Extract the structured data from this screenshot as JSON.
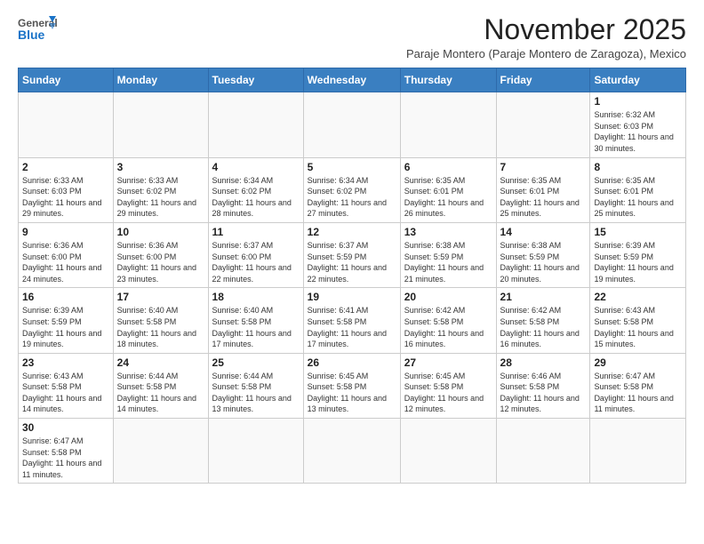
{
  "logo": {
    "general": "General",
    "blue": "Blue"
  },
  "title": "November 2025",
  "subtitle": "Paraje Montero (Paraje Montero de Zaragoza), Mexico",
  "weekdays": [
    "Sunday",
    "Monday",
    "Tuesday",
    "Wednesday",
    "Thursday",
    "Friday",
    "Saturday"
  ],
  "weeks": [
    [
      {
        "day": "",
        "info": ""
      },
      {
        "day": "",
        "info": ""
      },
      {
        "day": "",
        "info": ""
      },
      {
        "day": "",
        "info": ""
      },
      {
        "day": "",
        "info": ""
      },
      {
        "day": "",
        "info": ""
      },
      {
        "day": "1",
        "info": "Sunrise: 6:32 AM\nSunset: 6:03 PM\nDaylight: 11 hours and 30 minutes."
      }
    ],
    [
      {
        "day": "2",
        "info": "Sunrise: 6:33 AM\nSunset: 6:03 PM\nDaylight: 11 hours and 29 minutes."
      },
      {
        "day": "3",
        "info": "Sunrise: 6:33 AM\nSunset: 6:02 PM\nDaylight: 11 hours and 29 minutes."
      },
      {
        "day": "4",
        "info": "Sunrise: 6:34 AM\nSunset: 6:02 PM\nDaylight: 11 hours and 28 minutes."
      },
      {
        "day": "5",
        "info": "Sunrise: 6:34 AM\nSunset: 6:02 PM\nDaylight: 11 hours and 27 minutes."
      },
      {
        "day": "6",
        "info": "Sunrise: 6:35 AM\nSunset: 6:01 PM\nDaylight: 11 hours and 26 minutes."
      },
      {
        "day": "7",
        "info": "Sunrise: 6:35 AM\nSunset: 6:01 PM\nDaylight: 11 hours and 25 minutes."
      },
      {
        "day": "8",
        "info": "Sunrise: 6:35 AM\nSunset: 6:01 PM\nDaylight: 11 hours and 25 minutes."
      }
    ],
    [
      {
        "day": "9",
        "info": "Sunrise: 6:36 AM\nSunset: 6:00 PM\nDaylight: 11 hours and 24 minutes."
      },
      {
        "day": "10",
        "info": "Sunrise: 6:36 AM\nSunset: 6:00 PM\nDaylight: 11 hours and 23 minutes."
      },
      {
        "day": "11",
        "info": "Sunrise: 6:37 AM\nSunset: 6:00 PM\nDaylight: 11 hours and 22 minutes."
      },
      {
        "day": "12",
        "info": "Sunrise: 6:37 AM\nSunset: 5:59 PM\nDaylight: 11 hours and 22 minutes."
      },
      {
        "day": "13",
        "info": "Sunrise: 6:38 AM\nSunset: 5:59 PM\nDaylight: 11 hours and 21 minutes."
      },
      {
        "day": "14",
        "info": "Sunrise: 6:38 AM\nSunset: 5:59 PM\nDaylight: 11 hours and 20 minutes."
      },
      {
        "day": "15",
        "info": "Sunrise: 6:39 AM\nSunset: 5:59 PM\nDaylight: 11 hours and 19 minutes."
      }
    ],
    [
      {
        "day": "16",
        "info": "Sunrise: 6:39 AM\nSunset: 5:59 PM\nDaylight: 11 hours and 19 minutes."
      },
      {
        "day": "17",
        "info": "Sunrise: 6:40 AM\nSunset: 5:58 PM\nDaylight: 11 hours and 18 minutes."
      },
      {
        "day": "18",
        "info": "Sunrise: 6:40 AM\nSunset: 5:58 PM\nDaylight: 11 hours and 17 minutes."
      },
      {
        "day": "19",
        "info": "Sunrise: 6:41 AM\nSunset: 5:58 PM\nDaylight: 11 hours and 17 minutes."
      },
      {
        "day": "20",
        "info": "Sunrise: 6:42 AM\nSunset: 5:58 PM\nDaylight: 11 hours and 16 minutes."
      },
      {
        "day": "21",
        "info": "Sunrise: 6:42 AM\nSunset: 5:58 PM\nDaylight: 11 hours and 16 minutes."
      },
      {
        "day": "22",
        "info": "Sunrise: 6:43 AM\nSunset: 5:58 PM\nDaylight: 11 hours and 15 minutes."
      }
    ],
    [
      {
        "day": "23",
        "info": "Sunrise: 6:43 AM\nSunset: 5:58 PM\nDaylight: 11 hours and 14 minutes."
      },
      {
        "day": "24",
        "info": "Sunrise: 6:44 AM\nSunset: 5:58 PM\nDaylight: 11 hours and 14 minutes."
      },
      {
        "day": "25",
        "info": "Sunrise: 6:44 AM\nSunset: 5:58 PM\nDaylight: 11 hours and 13 minutes."
      },
      {
        "day": "26",
        "info": "Sunrise: 6:45 AM\nSunset: 5:58 PM\nDaylight: 11 hours and 13 minutes."
      },
      {
        "day": "27",
        "info": "Sunrise: 6:45 AM\nSunset: 5:58 PM\nDaylight: 11 hours and 12 minutes."
      },
      {
        "day": "28",
        "info": "Sunrise: 6:46 AM\nSunset: 5:58 PM\nDaylight: 11 hours and 12 minutes."
      },
      {
        "day": "29",
        "info": "Sunrise: 6:47 AM\nSunset: 5:58 PM\nDaylight: 11 hours and 11 minutes."
      }
    ],
    [
      {
        "day": "30",
        "info": "Sunrise: 6:47 AM\nSunset: 5:58 PM\nDaylight: 11 hours and 11 minutes."
      },
      {
        "day": "",
        "info": ""
      },
      {
        "day": "",
        "info": ""
      },
      {
        "day": "",
        "info": ""
      },
      {
        "day": "",
        "info": ""
      },
      {
        "day": "",
        "info": ""
      },
      {
        "day": "",
        "info": ""
      }
    ]
  ]
}
